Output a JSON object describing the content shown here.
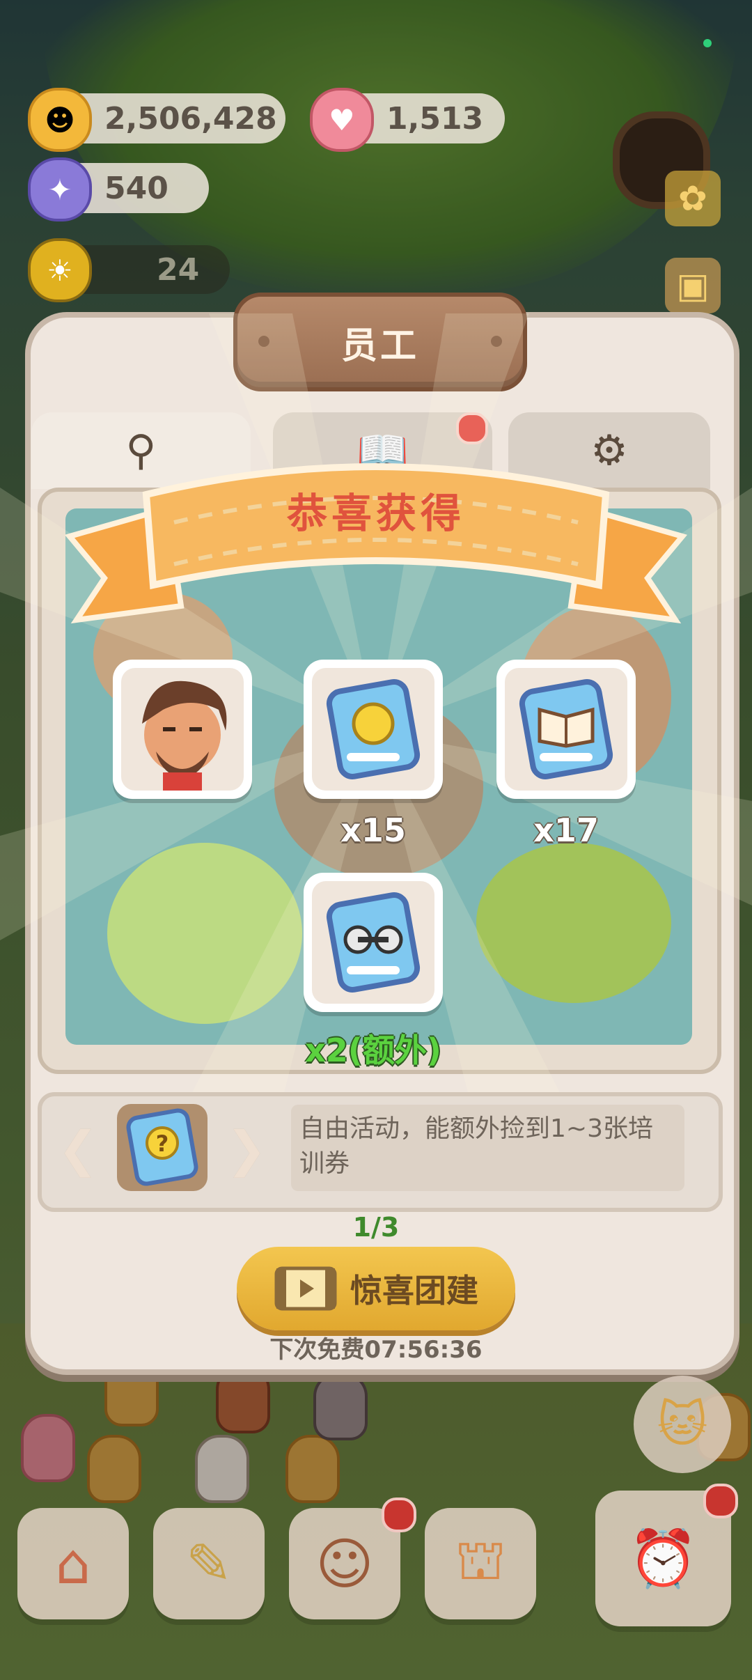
{
  "currency": {
    "coins": "2,506,428",
    "gems": "1,513",
    "tickets": "540",
    "sun_level": "24"
  },
  "panel": {
    "title": "员工"
  },
  "reward_popup": {
    "title": "恭喜获得",
    "items": [
      {
        "icon": "caveman-portrait-icon",
        "quantity": ""
      },
      {
        "icon": "strength-fist-card-icon",
        "quantity": "x15"
      },
      {
        "icon": "book-card-icon",
        "quantity": "x17"
      },
      {
        "icon": "dumbbell-card-icon",
        "quantity": "x2(额外)"
      }
    ]
  },
  "activity": {
    "description": "自由活动，能额外捡到1~3张培训券",
    "page": "1/3",
    "button_label": "惊喜团建",
    "free_timer": "下次免费07:56:36"
  },
  "colors": {
    "ribbon": "#f7b860",
    "ribbon_title": "#e0533d",
    "extra_qty": "#5bd23f",
    "cta": "#f3c64f",
    "badge": "#e3413b"
  }
}
